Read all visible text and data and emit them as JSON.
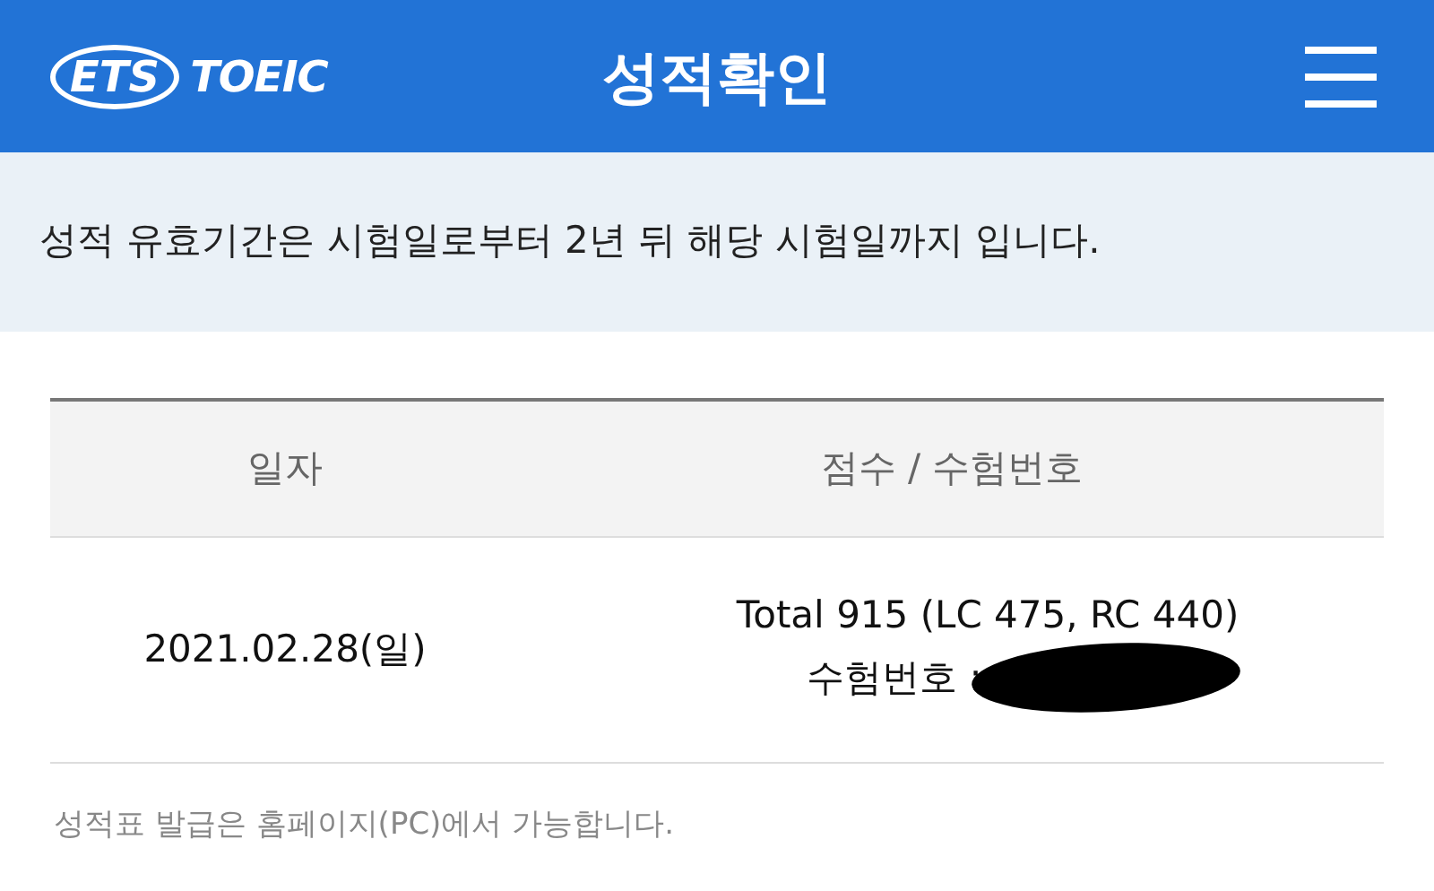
{
  "header": {
    "logo": {
      "brand": "ETS",
      "product": "TOEIC"
    },
    "title": "성적확인"
  },
  "notice": "성적 유효기간은 시험일로부터 2년 뒤 해당 시험일까지 입니다.",
  "table": {
    "columns": [
      "일자",
      "점수 / 수험번호"
    ],
    "rows": [
      {
        "date": "2021.02.28(일)",
        "score": "Total 915 (LC 475, RC 440)",
        "id_label": "수험번호 :",
        "id_redacted": true
      }
    ]
  },
  "footnote": "성적표 발급은 홈페이지(PC)에서 가능합니다."
}
